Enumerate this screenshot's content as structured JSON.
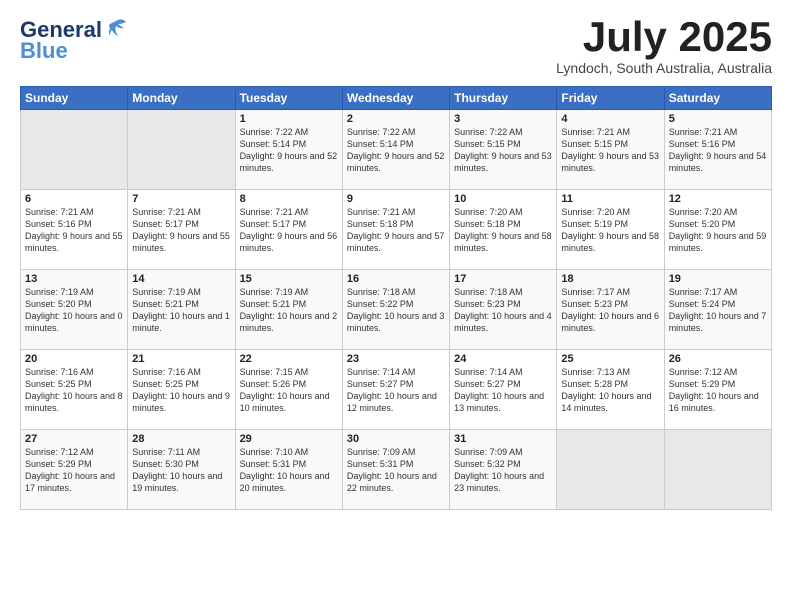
{
  "header": {
    "logo_line1": "General",
    "logo_line2": "Blue",
    "month": "July 2025",
    "location": "Lyndoch, South Australia, Australia"
  },
  "weekdays": [
    "Sunday",
    "Monday",
    "Tuesday",
    "Wednesday",
    "Thursday",
    "Friday",
    "Saturday"
  ],
  "weeks": [
    [
      {
        "day": "",
        "empty": true
      },
      {
        "day": "",
        "empty": true
      },
      {
        "day": "1",
        "sunrise": "7:22 AM",
        "sunset": "5:14 PM",
        "daylight": "9 hours and 52 minutes."
      },
      {
        "day": "2",
        "sunrise": "7:22 AM",
        "sunset": "5:14 PM",
        "daylight": "9 hours and 52 minutes."
      },
      {
        "day": "3",
        "sunrise": "7:22 AM",
        "sunset": "5:15 PM",
        "daylight": "9 hours and 53 minutes."
      },
      {
        "day": "4",
        "sunrise": "7:21 AM",
        "sunset": "5:15 PM",
        "daylight": "9 hours and 53 minutes."
      },
      {
        "day": "5",
        "sunrise": "7:21 AM",
        "sunset": "5:16 PM",
        "daylight": "9 hours and 54 minutes."
      }
    ],
    [
      {
        "day": "6",
        "sunrise": "7:21 AM",
        "sunset": "5:16 PM",
        "daylight": "9 hours and 55 minutes."
      },
      {
        "day": "7",
        "sunrise": "7:21 AM",
        "sunset": "5:17 PM",
        "daylight": "9 hours and 55 minutes."
      },
      {
        "day": "8",
        "sunrise": "7:21 AM",
        "sunset": "5:17 PM",
        "daylight": "9 hours and 56 minutes."
      },
      {
        "day": "9",
        "sunrise": "7:21 AM",
        "sunset": "5:18 PM",
        "daylight": "9 hours and 57 minutes."
      },
      {
        "day": "10",
        "sunrise": "7:20 AM",
        "sunset": "5:18 PM",
        "daylight": "9 hours and 58 minutes."
      },
      {
        "day": "11",
        "sunrise": "7:20 AM",
        "sunset": "5:19 PM",
        "daylight": "9 hours and 58 minutes."
      },
      {
        "day": "12",
        "sunrise": "7:20 AM",
        "sunset": "5:20 PM",
        "daylight": "9 hours and 59 minutes."
      }
    ],
    [
      {
        "day": "13",
        "sunrise": "7:19 AM",
        "sunset": "5:20 PM",
        "daylight": "10 hours and 0 minutes."
      },
      {
        "day": "14",
        "sunrise": "7:19 AM",
        "sunset": "5:21 PM",
        "daylight": "10 hours and 1 minute."
      },
      {
        "day": "15",
        "sunrise": "7:19 AM",
        "sunset": "5:21 PM",
        "daylight": "10 hours and 2 minutes."
      },
      {
        "day": "16",
        "sunrise": "7:18 AM",
        "sunset": "5:22 PM",
        "daylight": "10 hours and 3 minutes."
      },
      {
        "day": "17",
        "sunrise": "7:18 AM",
        "sunset": "5:23 PM",
        "daylight": "10 hours and 4 minutes."
      },
      {
        "day": "18",
        "sunrise": "7:17 AM",
        "sunset": "5:23 PM",
        "daylight": "10 hours and 6 minutes."
      },
      {
        "day": "19",
        "sunrise": "7:17 AM",
        "sunset": "5:24 PM",
        "daylight": "10 hours and 7 minutes."
      }
    ],
    [
      {
        "day": "20",
        "sunrise": "7:16 AM",
        "sunset": "5:25 PM",
        "daylight": "10 hours and 8 minutes."
      },
      {
        "day": "21",
        "sunrise": "7:16 AM",
        "sunset": "5:25 PM",
        "daylight": "10 hours and 9 minutes."
      },
      {
        "day": "22",
        "sunrise": "7:15 AM",
        "sunset": "5:26 PM",
        "daylight": "10 hours and 10 minutes."
      },
      {
        "day": "23",
        "sunrise": "7:14 AM",
        "sunset": "5:27 PM",
        "daylight": "10 hours and 12 minutes."
      },
      {
        "day": "24",
        "sunrise": "7:14 AM",
        "sunset": "5:27 PM",
        "daylight": "10 hours and 13 minutes."
      },
      {
        "day": "25",
        "sunrise": "7:13 AM",
        "sunset": "5:28 PM",
        "daylight": "10 hours and 14 minutes."
      },
      {
        "day": "26",
        "sunrise": "7:12 AM",
        "sunset": "5:29 PM",
        "daylight": "10 hours and 16 minutes."
      }
    ],
    [
      {
        "day": "27",
        "sunrise": "7:12 AM",
        "sunset": "5:29 PM",
        "daylight": "10 hours and 17 minutes."
      },
      {
        "day": "28",
        "sunrise": "7:11 AM",
        "sunset": "5:30 PM",
        "daylight": "10 hours and 19 minutes."
      },
      {
        "day": "29",
        "sunrise": "7:10 AM",
        "sunset": "5:31 PM",
        "daylight": "10 hours and 20 minutes."
      },
      {
        "day": "30",
        "sunrise": "7:09 AM",
        "sunset": "5:31 PM",
        "daylight": "10 hours and 22 minutes."
      },
      {
        "day": "31",
        "sunrise": "7:09 AM",
        "sunset": "5:32 PM",
        "daylight": "10 hours and 23 minutes."
      },
      {
        "day": "",
        "empty": true
      },
      {
        "day": "",
        "empty": true
      }
    ]
  ]
}
